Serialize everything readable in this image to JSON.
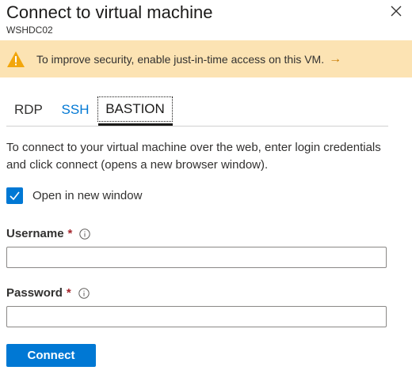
{
  "header": {
    "title": "Connect to virtual machine",
    "subtitle": "WSHDC02",
    "close_icon": "close-icon"
  },
  "warning": {
    "icon": "warning-icon",
    "message": "To improve security, enable just-in-time access on this VM.",
    "link_arrow": "→",
    "background_color": "#fce3b3"
  },
  "tabs": [
    {
      "label": "RDP",
      "selected": false
    },
    {
      "label": "SSH",
      "selected": false
    },
    {
      "label": "BASTION",
      "selected": true
    }
  ],
  "description": "To connect to your virtual machine over the web, enter login credentials and click connect (opens a new browser window).",
  "open_in_new_window": {
    "label": "Open in new window",
    "checked": true
  },
  "username": {
    "label": "Username",
    "required_mark": "*",
    "value": ""
  },
  "password": {
    "label": "Password",
    "required_mark": "*",
    "value": ""
  },
  "connect_button": {
    "label": "Connect"
  },
  "colors": {
    "accent": "#0078d4",
    "required": "#a4262c",
    "warning_icon": "#f2a60c"
  }
}
